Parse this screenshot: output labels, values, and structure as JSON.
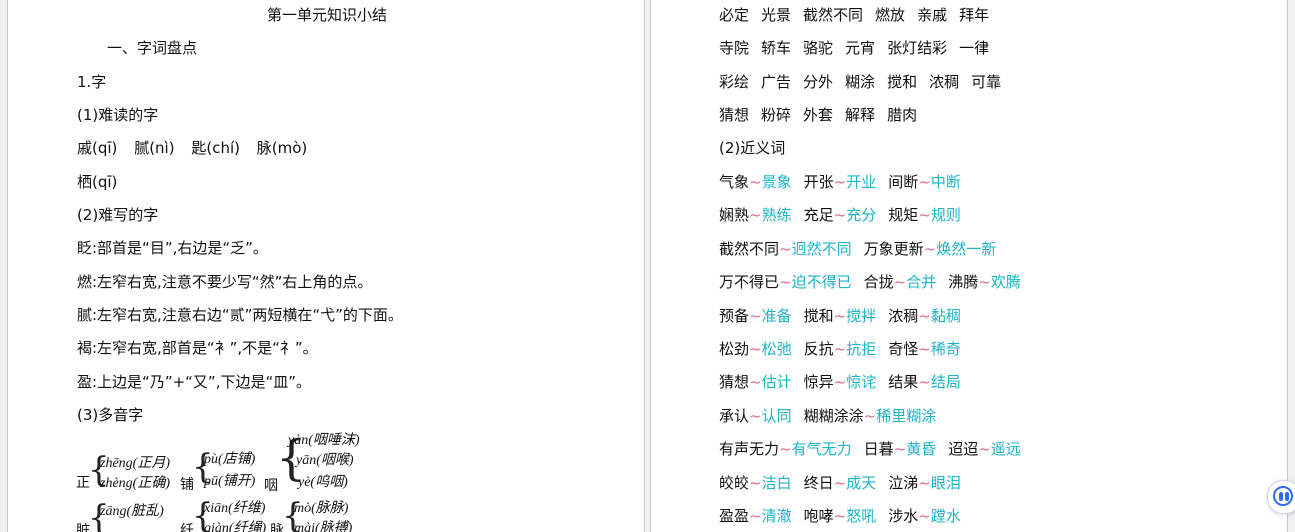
{
  "left": {
    "title": "第一单元知识小结",
    "section1": "一、字词盘点",
    "sub1": "1.字",
    "sub_hard_read": "(1)难读的字",
    "hard_read_row1": [
      "戚(qī)",
      "腻(nì)",
      "匙(chí)",
      "脉(mò)"
    ],
    "hard_read_row2": "栖(qī)",
    "sub_hard_write": "(2)难写的字",
    "write_lines": [
      "眨:部首是“目”,右边是“乏”。",
      "燃:左窄右宽,注意不要少写“然”右上角的点。",
      "腻:左窄右宽,注意右边“贰”两短横在“弋”的下面。",
      "褐:左窄右宽,部首是“衤”,不是“礻”。",
      "盈:上边是“乃”+“又”,下边是“皿”。"
    ],
    "sub_poly": "(3)多音字",
    "poly": [
      {
        "char": "正",
        "readings": [
          "zhēng(正月)",
          "zhèng(正确)"
        ]
      },
      {
        "char": "铺",
        "readings": [
          "pù(店铺)",
          "pū(铺开)"
        ]
      },
      {
        "char": "咽",
        "readings": [
          "yàn(咽唾沫)",
          "yān(咽喉)",
          "yè(呜咽)"
        ]
      },
      {
        "char": "脏",
        "readings": [
          "zāng(脏乱)"
        ]
      },
      {
        "char": "纤",
        "readings": [
          "xiān(纤维)",
          "qiàn(纤绳)"
        ]
      },
      {
        "char": "脉",
        "readings": [
          "mò(脉脉)",
          "mài(脉搏)"
        ]
      }
    ]
  },
  "right": {
    "word_rows": [
      [
        "必定",
        "光景",
        "截然不同",
        "燃放",
        "亲戚",
        "拜年"
      ],
      [
        "寺院",
        "轿车",
        "骆驼",
        "元宵",
        "张灯结彩",
        "一律"
      ],
      [
        "彩绘",
        "广告",
        "分外",
        "糊涂",
        "搅和",
        "浓稠",
        "可靠"
      ],
      [
        "猜想",
        "粉碎",
        "外套",
        "解释",
        "腊肉"
      ]
    ],
    "synonym_heading": "(2)近义词",
    "synonym_rows": [
      [
        [
          "气象",
          "景象"
        ],
        [
          "开张",
          "开业"
        ],
        [
          "间断",
          "中断"
        ]
      ],
      [
        [
          "娴熟",
          "熟练"
        ],
        [
          "充足",
          "充分"
        ],
        [
          "规矩",
          "规则"
        ]
      ],
      [
        [
          "截然不同",
          "迥然不同"
        ],
        [
          "万象更新",
          "焕然一新"
        ]
      ],
      [
        [
          "万不得已",
          "迫不得已"
        ],
        [
          "合拢",
          "合并"
        ],
        [
          "沸腾",
          "欢腾"
        ]
      ],
      [
        [
          "预备",
          "准备"
        ],
        [
          "搅和",
          "搅拌"
        ],
        [
          "浓稠",
          "黏稠"
        ]
      ],
      [
        [
          "松劲",
          "松弛"
        ],
        [
          "反抗",
          "抗拒"
        ],
        [
          "奇怪",
          "稀奇"
        ]
      ],
      [
        [
          "猜想",
          "估计"
        ],
        [
          "惊异",
          "惊诧"
        ],
        [
          "结果",
          "结局"
        ]
      ],
      [
        [
          "承认",
          "认同"
        ],
        [
          "糊糊涂涂",
          "稀里糊涂"
        ]
      ],
      [
        [
          "有声无力",
          "有气无力"
        ],
        [
          "日暮",
          "黄昏"
        ],
        [
          "迢迢",
          "遥远"
        ]
      ],
      [
        [
          "皎皎",
          "洁白"
        ],
        [
          "终日",
          "成天"
        ],
        [
          "泣涕",
          "眼泪"
        ]
      ],
      [
        [
          "盈盈",
          "清澈"
        ],
        [
          "咆哮",
          "怒吼"
        ],
        [
          "涉水",
          "蹚水"
        ]
      ]
    ],
    "tilde": "~"
  },
  "colors": {
    "synonym_answer": "#1cb4c8",
    "tilde": "#e06a8a",
    "assistant_button": "#2f6df0"
  },
  "icons": {
    "assistant": "assistant-face-icon"
  }
}
